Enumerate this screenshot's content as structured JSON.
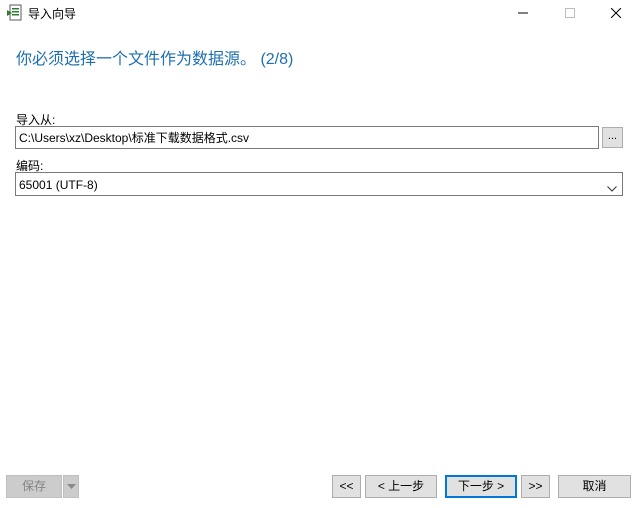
{
  "window": {
    "title": "导入向导"
  },
  "page": {
    "heading": "你必须选择一个文件作为数据源。 (2/8)"
  },
  "form": {
    "import_from_label": "导入从:",
    "file_path": "C:\\Users\\xz\\Desktop\\标准下载数据格式.csv",
    "browse_label": "...",
    "encoding_label": "编码:",
    "encoding_value": "65001 (UTF-8)"
  },
  "footer": {
    "save_label": "保存",
    "first_label": "<<",
    "prev_label": "< 上一步",
    "next_label": "下一步 >",
    "last_label": ">>",
    "cancel_label": "取消"
  },
  "colors": {
    "heading": "#1e6fb0",
    "focus_border": "#0078d7",
    "button_face": "#e1e1e1",
    "disabled_face": "#cccccc"
  }
}
